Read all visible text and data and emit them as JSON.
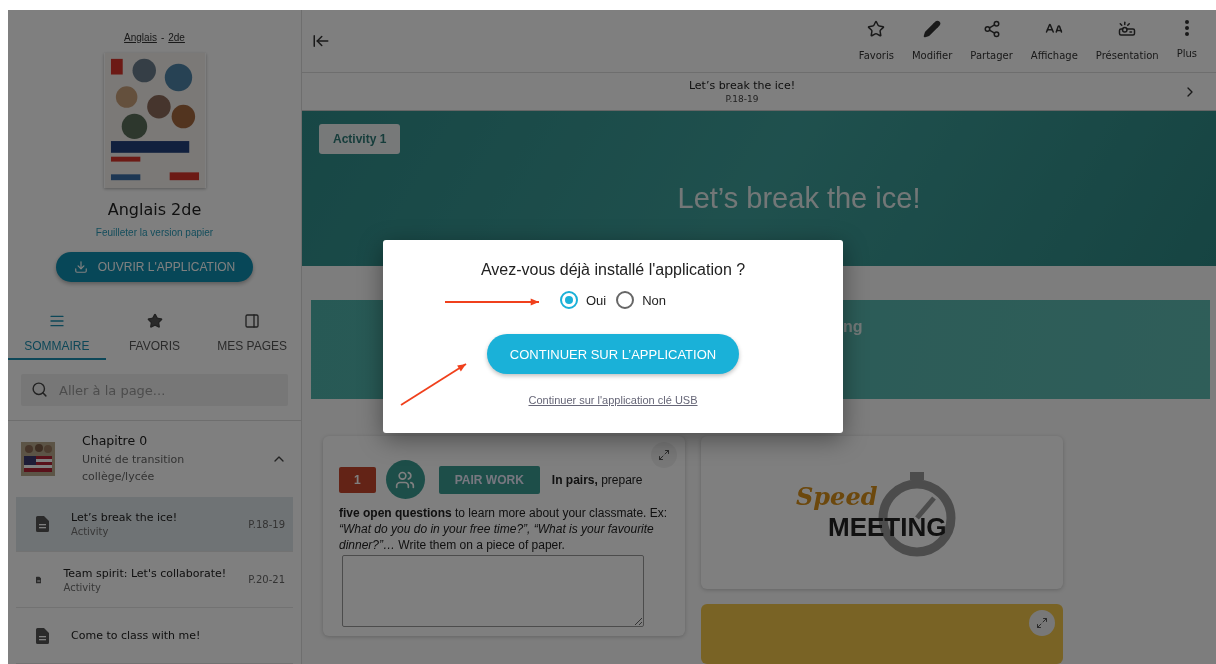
{
  "breadcrumb": {
    "items": [
      "Anglais",
      "2de"
    ],
    "separator": "-"
  },
  "book": {
    "title": "Anglais 2de",
    "link": "Feuilleter la version papier",
    "open_button": "OUVRIR L'APPLICATION"
  },
  "sidebar_tabs": [
    {
      "label": "SOMMAIRE",
      "selected": true
    },
    {
      "label": "FAVORIS",
      "selected": false
    },
    {
      "label": "MES PAGES",
      "selected": false
    }
  ],
  "search": {
    "placeholder": "Aller à la page..."
  },
  "chapter": {
    "title": "Chapitre 0",
    "subtitle": "Unité de transition collège/lycée",
    "expanded": true
  },
  "lessons": [
    {
      "title": "Let’s break the ice!",
      "type": "Activity",
      "pages": "P.18-19",
      "selected": true
    },
    {
      "title": "Team spirit: Let's collaborate!",
      "type": "Activity",
      "pages": "P.20-21",
      "selected": false
    },
    {
      "title": "Come to class with me!",
      "selected": false
    }
  ],
  "toolbar": {
    "actions": [
      {
        "label": "Favoris"
      },
      {
        "label": "Modifier"
      },
      {
        "label": "Partager"
      },
      {
        "label": "Affichage"
      },
      {
        "label": "Présentation"
      },
      {
        "label": "Plus"
      }
    ]
  },
  "page_header": {
    "title": "Let’s break the ice!",
    "pages": "P.18-19"
  },
  "banner": {
    "tag": "Activity 1",
    "title": "Let’s break the ice!"
  },
  "section_banner": {
    "title": "ng"
  },
  "exercise": {
    "number": "1",
    "tag": "PAIR WORK",
    "lead": "**In pairs,** prepare",
    "text": "**five open questions** to learn more about your classmate. Ex: *“What do you do in your free time?”, “What is your favourite dinner?”…* Write them on a piece of paper."
  },
  "speed_meeting": {
    "script": "Speed",
    "word": "MEETING"
  },
  "dialog": {
    "question": "Avez-vous déjà installé l'application ?",
    "options": [
      {
        "label": "Oui",
        "selected": true
      },
      {
        "label": "Non",
        "selected": false
      }
    ],
    "primary_button": "CONTINUER SUR L’APPLICATION",
    "secondary_link": "Continuer sur l'application clé USB"
  }
}
